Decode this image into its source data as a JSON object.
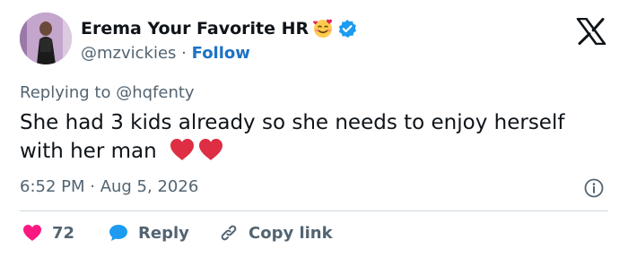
{
  "author": {
    "display_name": "Erema Your Favorite HR",
    "handle": "@mzvickies",
    "separator": "·",
    "follow_label": "Follow"
  },
  "reply_context": {
    "prefix": "Replying to",
    "mention": "@hqfenty"
  },
  "tweet": {
    "text": "She had 3 kids already so she needs to enjoy herself with her man",
    "timestamp": "6:52 PM · Aug 5, 2026"
  },
  "actions": {
    "like_count": "72",
    "reply_label": "Reply",
    "copy_link_label": "Copy link"
  },
  "colors": {
    "accent_blue": "#1d9bf0",
    "follow_blue": "#1d72c4",
    "like_pink": "#f91880",
    "heart_red": "#e0245e",
    "muted_text": "#536471"
  },
  "icons": {
    "avatar": "profile-photo",
    "name_emoji": "smiling-face-with-hearts-icon",
    "verified": "verified-badge-icon",
    "brand": "x-logo-icon",
    "inline_emoji": "red-heart-icon",
    "info": "info-icon",
    "like": "heart-icon",
    "reply": "speech-bubble-icon",
    "copy": "link-icon"
  }
}
